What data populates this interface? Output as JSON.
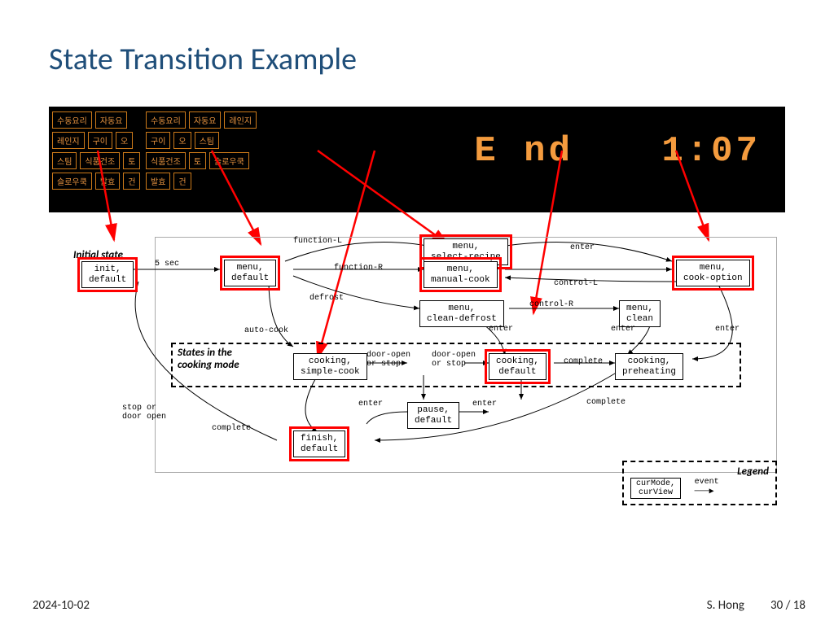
{
  "title": "State Transition Example",
  "panel1_buttons": [
    "수동요리",
    "자동요",
    "레인지",
    "구이",
    "오",
    "스팀",
    "식품건조",
    "토",
    "슬로우쿡",
    "발효",
    "건"
  ],
  "panel2_buttons": [
    "수동요리",
    "자동요",
    "레인지",
    "구이",
    "오",
    "스팀",
    "식품건조",
    "토",
    "슬로우쿡",
    "발효",
    "건"
  ],
  "display_end": "E nd",
  "display_time": "1:07",
  "initial_label": "Initial state",
  "cooking_label": "States in the\ncooking mode",
  "legend_title": "Legend",
  "legend_state": "curMode,\ncurView",
  "legend_event": "event",
  "states": {
    "init": "init,\ndefault",
    "menu_default": "menu,\ndefault",
    "menu_select": "menu,\nselect-recipe",
    "menu_manual": "menu,\nmanual-cook",
    "menu_cookopt": "menu,\ncook-option",
    "menu_cleandef": "menu,\nclean-defrost",
    "menu_clean": "menu,\nclean",
    "cook_simple": "cooking,\nsimple-cook",
    "cook_default": "cooking,\ndefault",
    "cook_preheat": "cooking,\npreheating",
    "pause": "pause,\ndefault",
    "finish": "finish,\ndefault"
  },
  "edges": {
    "e5sec": "5 sec",
    "funcL": "function-L",
    "funcR": "function-R",
    "enter": "enter",
    "controlL": "control-L",
    "controlR": "control-R",
    "defrost": "defrost",
    "autocook": "auto-cook",
    "dooropen": "door-open\nor stop",
    "complete": "complete",
    "stopdoor": "stop or\ndoor open"
  },
  "footer": {
    "date": "2024-10-02",
    "author": "S. Hong",
    "page": "30 / 18"
  }
}
